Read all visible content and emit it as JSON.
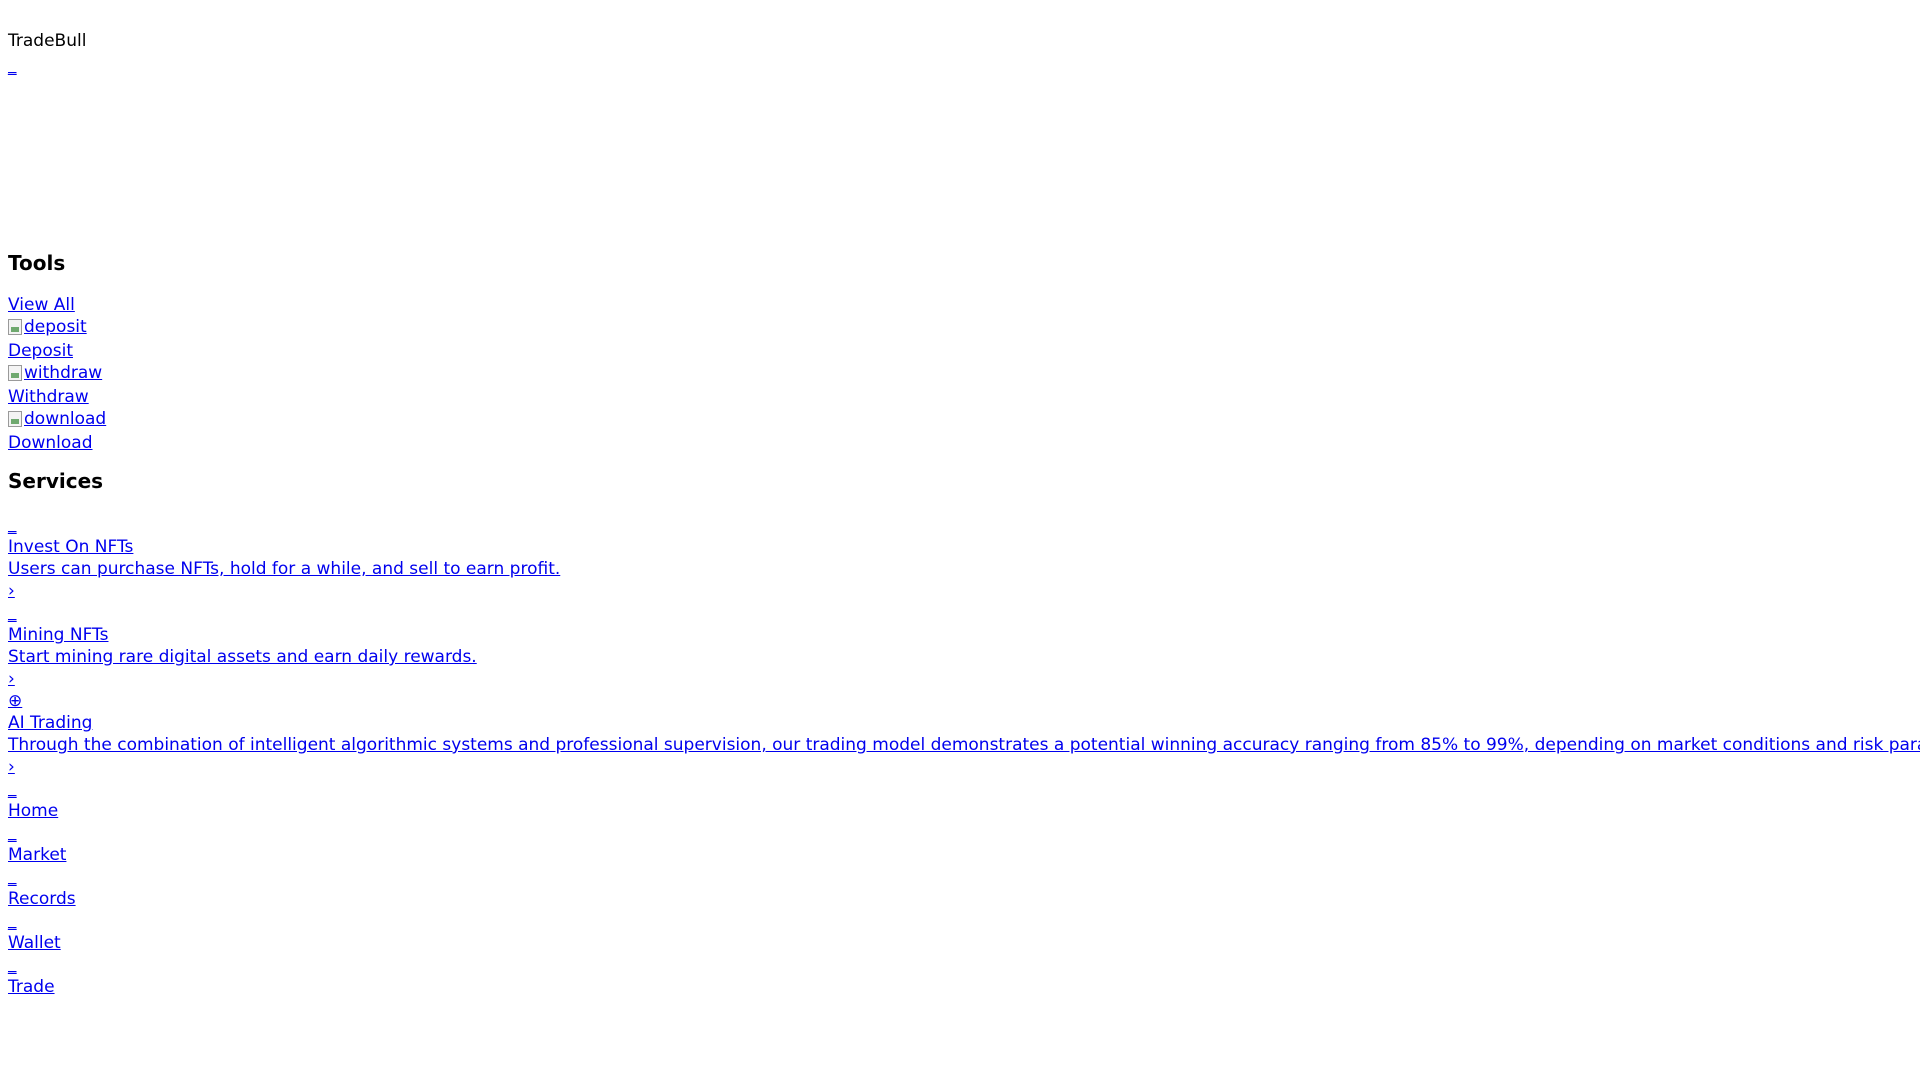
{
  "header": {
    "brand": "TradeBull",
    "menu_glyph": "_"
  },
  "tools": {
    "title": "Tools",
    "view_all": "View All",
    "items": [
      {
        "img_alt": "deposit",
        "label": "Deposit"
      },
      {
        "img_alt": "withdraw",
        "label": "Withdraw"
      },
      {
        "img_alt": "download",
        "label": "Download"
      }
    ]
  },
  "services": {
    "title": "Services",
    "items": [
      {
        "icon": "_",
        "title": "Invest On NFTs",
        "description": "Users can purchase NFTs, hold for a while, and sell to earn profit.",
        "chevron": "›"
      },
      {
        "icon": "_",
        "title": "Mining NFTs",
        "description": "Start mining rare digital assets and earn daily rewards.",
        "chevron": "›"
      },
      {
        "icon": "⊕",
        "title": "AI Trading",
        "description": "Through the combination of intelligent algorithmic systems and professional supervision, our trading model demonstrates a potential winning accuracy ranging from 85% to 99%, depending on market conditions and risk parameters.",
        "chevron": "›"
      }
    ]
  },
  "bottom_nav": {
    "items": [
      {
        "icon": "_",
        "label": "Home"
      },
      {
        "icon": "_",
        "label": "Market"
      },
      {
        "icon": "_",
        "label": "Records"
      },
      {
        "icon": "_",
        "label": "Wallet"
      },
      {
        "icon": "_",
        "label": "Trade"
      }
    ]
  },
  "colors": {
    "link": "#0000ee",
    "text": "#000000",
    "background": "#ffffff"
  }
}
